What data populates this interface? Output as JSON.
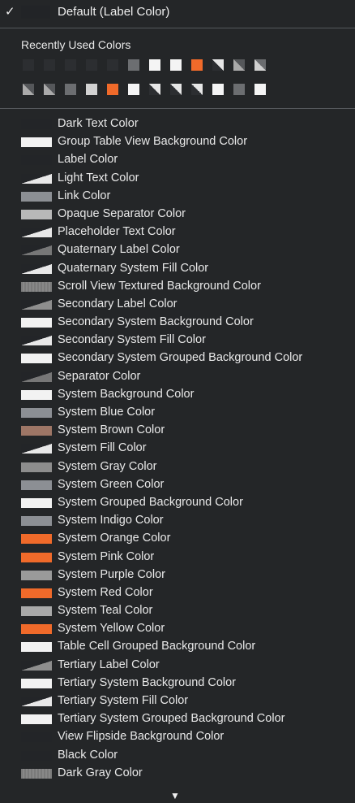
{
  "default_item": {
    "check": "✓",
    "label": "Default (Label Color)"
  },
  "recent": {
    "title": "Recently Used Colors",
    "row1": [
      "c-dark",
      "c-dark",
      "c-dark",
      "c-dark",
      "c-dark",
      "c-gray",
      "c-white",
      "c-white",
      "c-orange",
      "c-tri",
      "c-tri2",
      "c-tri3"
    ],
    "row2": [
      "c-tri2",
      "c-tri2",
      "c-gray",
      "c-light",
      "c-orange",
      "c-white",
      "c-tri",
      "c-tri",
      "c-tri",
      "c-white",
      "c-gray",
      "c-white"
    ]
  },
  "colors": [
    {
      "label": "Dark Text Color",
      "swatch": "dark"
    },
    {
      "label": "Group Table View Background Color",
      "swatch": "white"
    },
    {
      "label": "Label Color",
      "swatch": "dark"
    },
    {
      "label": "Light Text Color",
      "swatch": "tri"
    },
    {
      "label": "Link Color",
      "swatch": "grayblue"
    },
    {
      "label": "Opaque Separator Color",
      "swatch": "lightgray"
    },
    {
      "label": "Placeholder Text Color",
      "swatch": "tri"
    },
    {
      "label": "Quaternary Label Color",
      "swatch": "tri-dim"
    },
    {
      "label": "Quaternary System Fill Color",
      "swatch": "tri"
    },
    {
      "label": "Scroll View Textured Background Color",
      "swatch": "textured"
    },
    {
      "label": "Secondary Label Color",
      "swatch": "tri-gray"
    },
    {
      "label": "Secondary System Background Color",
      "swatch": "white"
    },
    {
      "label": "Secondary System Fill Color",
      "swatch": "tri"
    },
    {
      "label": "Secondary System Grouped Background Color",
      "swatch": "white"
    },
    {
      "label": "Separator Color",
      "swatch": "tri-dim"
    },
    {
      "label": "System Background Color",
      "swatch": "white"
    },
    {
      "label": "System Blue Color",
      "swatch": "grayblue"
    },
    {
      "label": "System Brown Color",
      "swatch": "brown"
    },
    {
      "label": "System Fill Color",
      "swatch": "tri"
    },
    {
      "label": "System Gray Color",
      "swatch": "gray"
    },
    {
      "label": "System Green Color",
      "swatch": "grayblue"
    },
    {
      "label": "System Grouped Background Color",
      "swatch": "white"
    },
    {
      "label": "System Indigo Color",
      "swatch": "grayblue"
    },
    {
      "label": "System Orange Color",
      "swatch": "orange"
    },
    {
      "label": "System Pink Color",
      "swatch": "orange"
    },
    {
      "label": "System Purple Color",
      "swatch": "midgray"
    },
    {
      "label": "System Red Color",
      "swatch": "orange"
    },
    {
      "label": "System Teal Color",
      "swatch": "teal"
    },
    {
      "label": "System Yellow Color",
      "swatch": "orange"
    },
    {
      "label": "Table Cell Grouped Background Color",
      "swatch": "white"
    },
    {
      "label": "Tertiary Label Color",
      "swatch": "tri-gray"
    },
    {
      "label": "Tertiary System Background Color",
      "swatch": "white"
    },
    {
      "label": "Tertiary System Fill Color",
      "swatch": "tri"
    },
    {
      "label": "Tertiary System Grouped Background Color",
      "swatch": "white"
    },
    {
      "label": "View Flipside Background Color",
      "swatch": "dark"
    },
    {
      "label": "Black Color",
      "swatch": "dark"
    },
    {
      "label": "Dark Gray Color",
      "swatch": "textured"
    }
  ],
  "scroll_indicator": "▼"
}
